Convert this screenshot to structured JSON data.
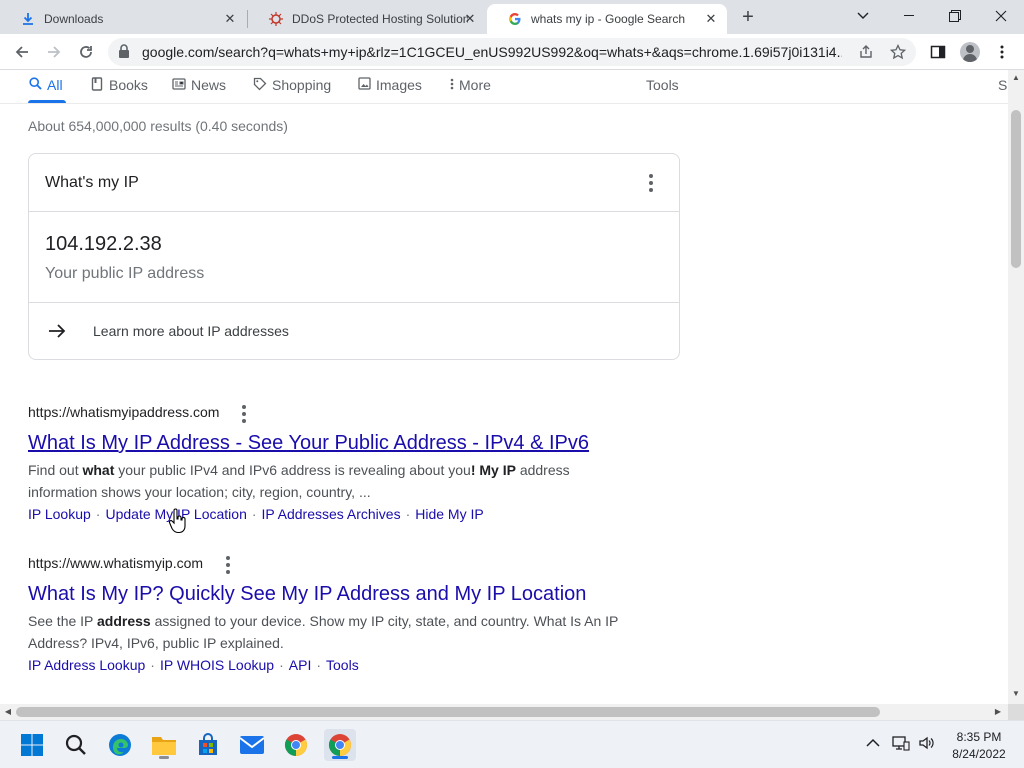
{
  "browser": {
    "tabs": [
      {
        "label": "Downloads",
        "icon": "download-icon"
      },
      {
        "label": "DDoS Protected Hosting Solution",
        "icon": "site-favicon"
      },
      {
        "label": "whats my ip - Google Search",
        "icon": "google-icon"
      }
    ],
    "new_tab": "+",
    "url": "google.com/search?q=whats+my+ip&rlz=1C1GCEU_enUS992US992&oq=whats+&aqs=chrome.1.69i57j0i131i4..."
  },
  "search_tabs": [
    {
      "label": "All",
      "icon": "search-icon"
    },
    {
      "label": "Books",
      "icon": "book-icon"
    },
    {
      "label": "News",
      "icon": "news-icon"
    },
    {
      "label": "Shopping",
      "icon": "tag-icon"
    },
    {
      "label": "Images",
      "icon": "image-icon"
    },
    {
      "label": "More",
      "icon": "more-vert-icon"
    }
  ],
  "tools_label": "Tools",
  "extra_tab_cut": "S",
  "stats": "About 654,000,000 results (0.40 seconds)",
  "ip_card": {
    "title": "What's my IP",
    "ip": "104.192.2.38",
    "subtitle": "Your public IP address",
    "learn_more": "Learn more about IP addresses"
  },
  "results": [
    {
      "url": "https://whatismyipaddress.com",
      "title": "What Is My IP Address - See Your Public Address - IPv4 & IPv6",
      "snippet_line1_parts": [
        "Find out ",
        "what",
        " your public IPv4 and IPv6 address is revealing about you",
        "! My IP",
        " address"
      ],
      "snippet_line2": "information shows your location; city, region, country, ...",
      "sitelinks": [
        "IP Lookup",
        "Update My IP Location",
        "IP Addresses Archives",
        "Hide My IP"
      ]
    },
    {
      "url": "https://www.whatismyip.com",
      "title": "What Is My IP? Quickly See My IP Address and My IP Location",
      "snippet_line1_parts": [
        "See the IP ",
        "address",
        " assigned to your device. Show my IP city, state, and country. What Is An IP"
      ],
      "snippet_line2": "Address? IPv4, IPv6, public IP explained.",
      "sitelinks": [
        "IP Address Lookup",
        "IP WHOIS Lookup",
        "API",
        "Tools"
      ]
    }
  ],
  "sitelink_separator": "·",
  "taskbar": {
    "time": "8:35 PM",
    "date": "8/24/2022"
  },
  "colors": {
    "link": "#1a0dab",
    "accent": "#1a73e8",
    "tab_strip": "#dee1e6"
  }
}
